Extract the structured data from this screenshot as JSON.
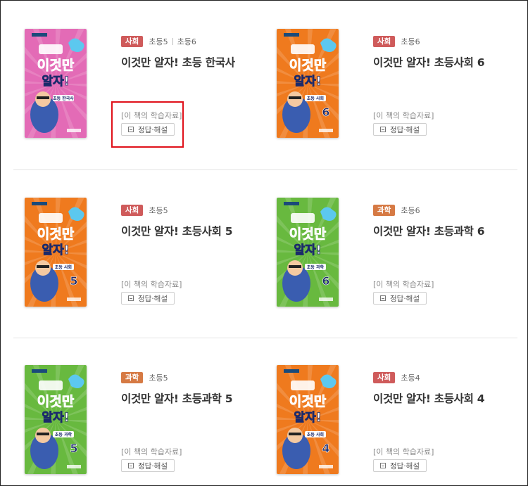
{
  "colors": {
    "social": "#cf5b5b",
    "science": "#d67a44",
    "highlight": "#e0111a"
  },
  "common": {
    "materials_label": "[이 책의 학습자료]",
    "answer_label": "정답·해설"
  },
  "books": [
    {
      "subject": "사회",
      "subject_color": "#cf5b5b",
      "grades": [
        "초등5",
        "초등6"
      ],
      "title": "이것만 알자! 초등 한국사",
      "cover": {
        "bg": "#e36bb6",
        "main_text": "이것만 알자!",
        "label": "초등 한국사",
        "number": ""
      }
    },
    {
      "subject": "사회",
      "subject_color": "#cf5b5b",
      "grades": [
        "초등6"
      ],
      "title": "이것만 알자! 초등사회 6",
      "cover": {
        "bg": "#ef7a1e",
        "main_text": "이것만 알자!",
        "label": "초등 사회",
        "number": "6"
      }
    },
    {
      "subject": "사회",
      "subject_color": "#cf5b5b",
      "grades": [
        "초등5"
      ],
      "title": "이것만 알자! 초등사회 5",
      "cover": {
        "bg": "#ef7a1e",
        "main_text": "이것만 알자!",
        "label": "초등 사회",
        "number": "5"
      }
    },
    {
      "subject": "과학",
      "subject_color": "#d67a44",
      "grades": [
        "초등6"
      ],
      "title": "이것만 알자! 초등과학 6",
      "cover": {
        "bg": "#68b93f",
        "main_text": "이것만 알자!",
        "label": "초등 과학",
        "number": "6"
      }
    },
    {
      "subject": "과학",
      "subject_color": "#d67a44",
      "grades": [
        "초등5"
      ],
      "title": "이것만 알자! 초등과학 5",
      "cover": {
        "bg": "#68b93f",
        "main_text": "이것만 알자!",
        "label": "초등 과학",
        "number": "5"
      }
    },
    {
      "subject": "사회",
      "subject_color": "#cf5b5b",
      "grades": [
        "초등4"
      ],
      "title": "이것만 알자! 초등사회 4",
      "cover": {
        "bg": "#ef7a1e",
        "main_text": "이것만 알자!",
        "label": "초등 사회",
        "number": "4"
      }
    }
  ]
}
